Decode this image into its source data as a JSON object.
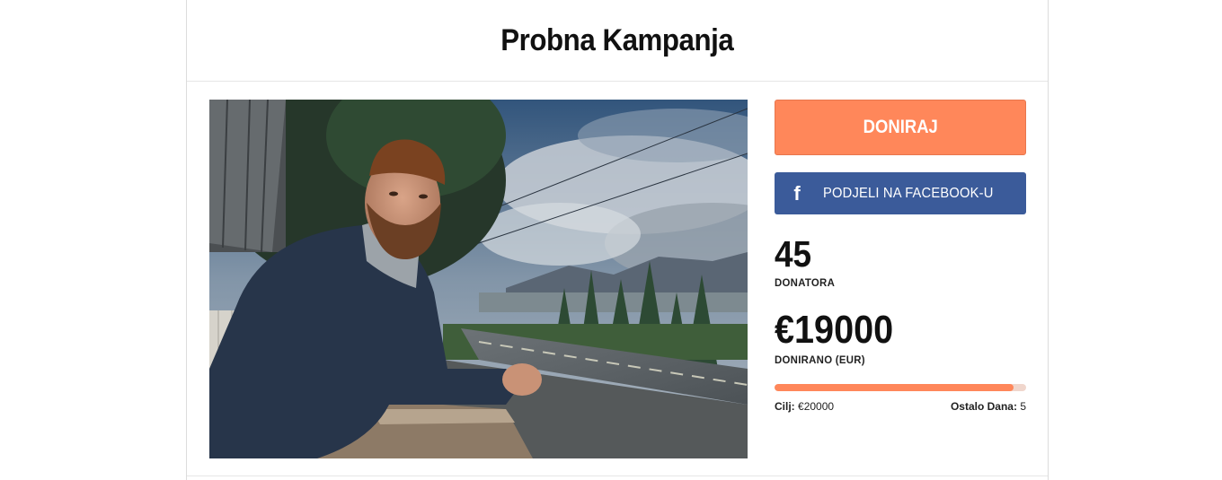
{
  "campaign": {
    "title": "Probna Kampanja"
  },
  "actions": {
    "donate_label": "DONIRAJ",
    "facebook_label": "PODJELI NA FACEBOOK-U",
    "facebook_icon": "f"
  },
  "stats": {
    "donors_count": "45",
    "donors_label": "DONATORA",
    "donated_amount": "€19000",
    "donated_label": "DONIRANO (EUR)"
  },
  "progress": {
    "fraction": 0.95
  },
  "goal": {
    "label": "Cilj:",
    "value": "€20000"
  },
  "days_left": {
    "label": "Ostalo Dana:",
    "value": "5"
  },
  "colors": {
    "donate_button": "#ff875a",
    "facebook_button": "#3b5b9a",
    "progress_fill": "#ff875a"
  },
  "image": {
    "icon": "campaign-photo"
  }
}
